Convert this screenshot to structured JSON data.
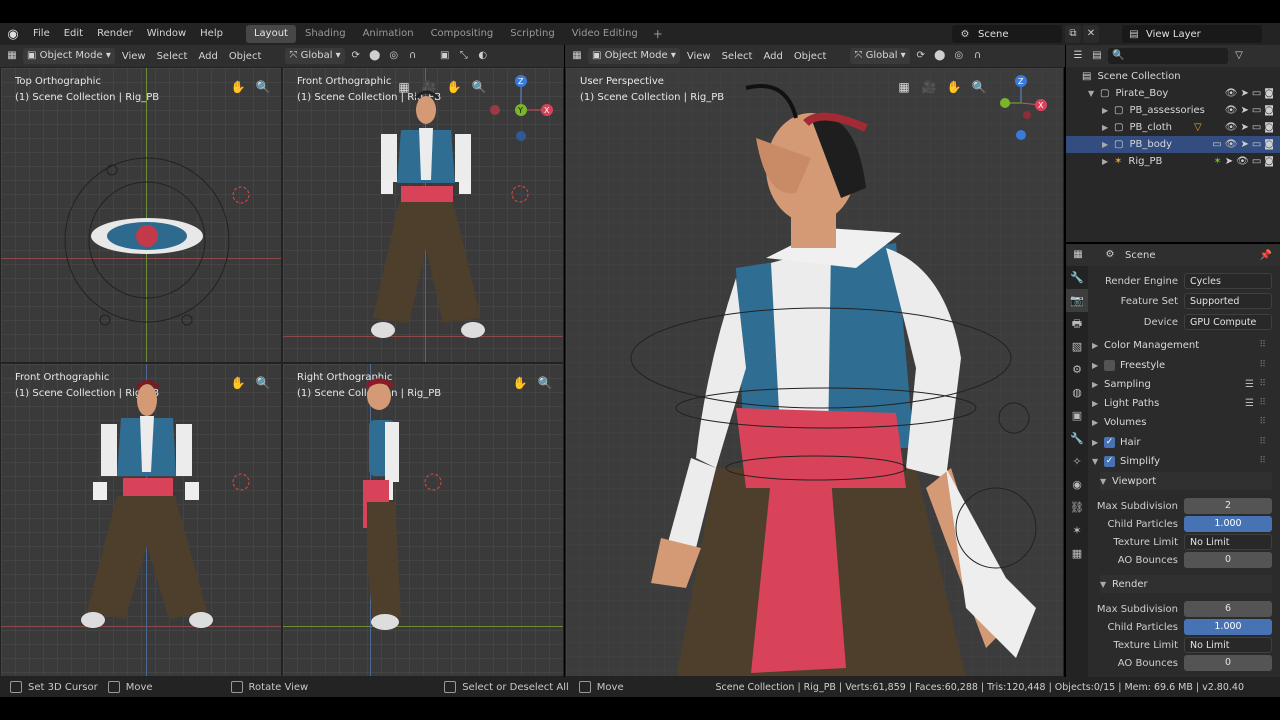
{
  "menu": [
    "File",
    "Edit",
    "Render",
    "Window",
    "Help"
  ],
  "workspaces": [
    "Layout",
    "Shading",
    "Animation",
    "Compositing",
    "Scripting",
    "Video Editing"
  ],
  "active_workspace": "Layout",
  "scene_name": "Scene",
  "view_layer": "View Layer",
  "left_header": {
    "mode": "Object Mode",
    "view": "View",
    "select": "Select",
    "add": "Add",
    "object": "Object",
    "orientation": "Global"
  },
  "right_header": {
    "mode": "Object Mode",
    "view": "View",
    "select": "Select",
    "add": "Add",
    "object": "Object",
    "orientation": "Global"
  },
  "viewports": {
    "top": {
      "title": "Top Orthographic",
      "collection": "(1) Scene Collection | Rig_PB"
    },
    "front": {
      "title": "Front Orthographic",
      "collection": "(1) Scene Collection | Rig_PB"
    },
    "front2": {
      "title": "Front Orthographic",
      "collection": "(1) Scene Collection | Rig_PB"
    },
    "right": {
      "title": "Right Orthographic",
      "collection": "(1) Scene Collection | Rig_PB"
    },
    "persp": {
      "title": "User Perspective",
      "collection": "(1) Scene Collection | Rig_PB"
    }
  },
  "gizmo": {
    "x": "X",
    "y": "Y",
    "z": "Z"
  },
  "outliner": {
    "root": "Scene Collection",
    "items": [
      "Pirate_Boy",
      "PB_assessories",
      "PB_cloth",
      "PB_body",
      "Rig_PB"
    ],
    "selected": "PB_body"
  },
  "properties": {
    "context": "Scene",
    "render_engine_label": "Render Engine",
    "render_engine": "Cycles",
    "feature_set_label": "Feature Set",
    "feature_set": "Supported",
    "device_label": "Device",
    "device": "GPU Compute",
    "panels": [
      "Color Management",
      "Freestyle",
      "Sampling",
      "Light Paths",
      "Volumes",
      "Hair",
      "Simplify"
    ],
    "viewport_section": "Viewport",
    "render_section": "Render",
    "labels": {
      "max_subdivision": "Max Subdivision",
      "child_particles": "Child Particles",
      "texture_limit": "Texture Limit",
      "ao_bounces": "AO Bounces"
    },
    "viewport": {
      "max_subdivision": "2",
      "child_particles": "1.000",
      "texture_limit": "No Limit",
      "ao_bounces": "0"
    },
    "render": {
      "max_subdivision": "6",
      "child_particles": "1.000",
      "texture_limit": "No Limit",
      "ao_bounces": "0"
    }
  },
  "status": {
    "set_cursor": "Set 3D Cursor",
    "move": "Move",
    "rotate": "Rotate View",
    "select": "Select or Deselect All",
    "move2": "Move",
    "stats": "Scene Collection | Rig_PB | Verts:61,859 | Faces:60,288 | Tris:120,448 | Objects:0/15 | Mem: 69.6 MB | v2.80.40"
  },
  "colors": {
    "accent": "#4772b3",
    "selection": "#334d80",
    "vest": "#2f6e92",
    "sash": "#d8435a",
    "pants": "#4e3f2d",
    "skin": "#d49a76"
  }
}
